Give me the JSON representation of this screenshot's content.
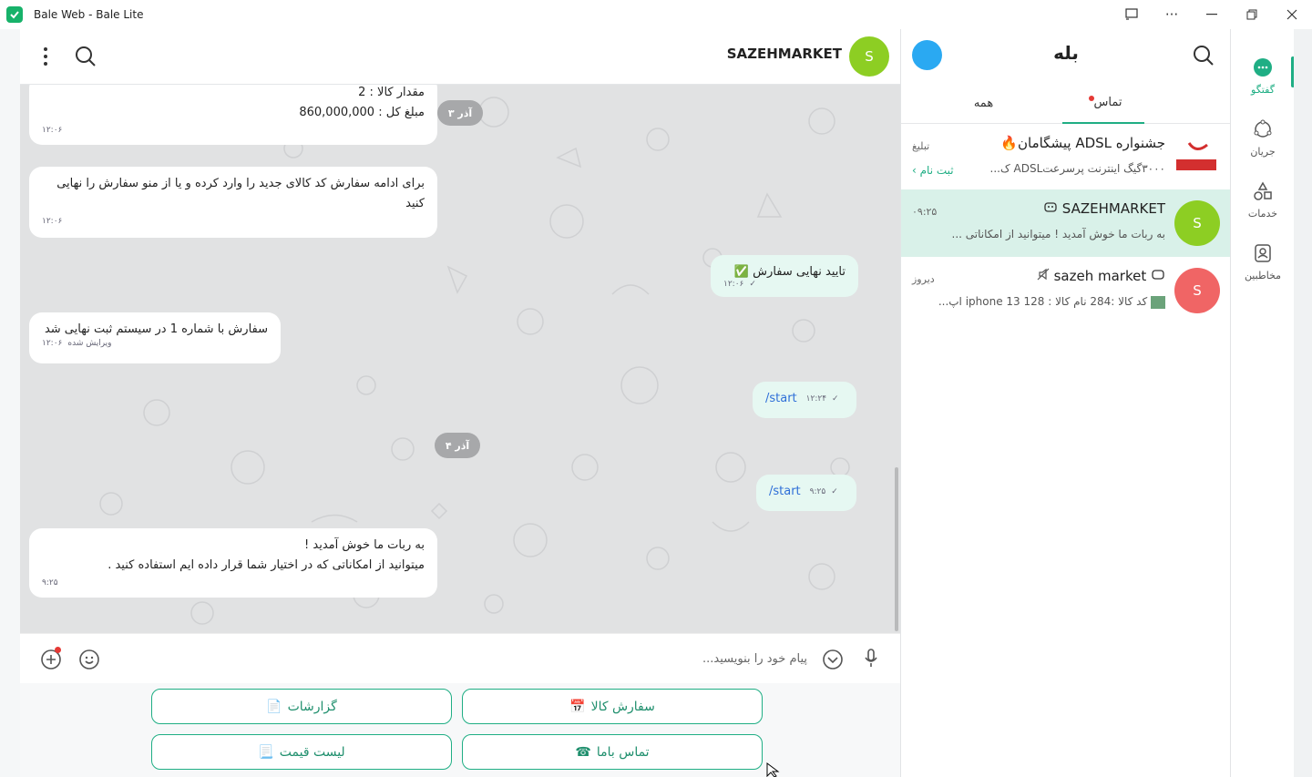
{
  "window": {
    "title": "Bale Web - Bale Lite",
    "controls": [
      "cast",
      "more",
      "minimize",
      "maximize",
      "close"
    ]
  },
  "chat": {
    "header": {
      "name": "SAZEHMARKET",
      "avatar_letter": "S"
    },
    "messages": [
      {
        "dir": "in",
        "lines": [
          "مقدار کالا  :  2",
          "مبلغ کل : 860,000,000"
        ],
        "time": "۱۲:۰۶"
      },
      {
        "dir": "in",
        "lines": [
          "برای ادامه سفارش کد کالای جدید را وارد کرده و یا از منو  سفارش را نهایی",
          "کنید"
        ],
        "time": "۱۲:۰۶"
      },
      {
        "dir": "out",
        "lines": [
          "تایید نهایی سفارش ✅"
        ],
        "time": "۱۲:۰۶"
      },
      {
        "dir": "in",
        "lines": [
          "سفارش با شماره 1 در سیستم ثبت نهایی شد"
        ],
        "time": "۱۲:۰۶",
        "edited": "ویرایش شده"
      },
      {
        "dir": "out",
        "lines": [
          "/start"
        ],
        "time": "۱۲:۲۴"
      },
      {
        "dir": "out",
        "lines": [
          "/start"
        ],
        "time": "۹:۲۵"
      },
      {
        "dir": "in",
        "lines": [
          "به ربات ما خوش آمدید !",
          "میتوانید از امکاناتی که در اختیار شما قرار داده ایم استفاده کنید ."
        ],
        "time": "۹:۲۵"
      }
    ],
    "dates": [
      "۳ آذر",
      "۴ آذر"
    ],
    "composer": {
      "placeholder": "پیام خود را بنویسید..."
    },
    "keyboard": [
      {
        "label": "سفارش کالا",
        "emoji": "📅"
      },
      {
        "label": "گزارشات",
        "emoji": "📄"
      },
      {
        "label": "تماس باما",
        "emoji": "☎"
      },
      {
        "label": "لیست قیمت",
        "emoji": "📃"
      }
    ]
  },
  "list": {
    "title": "بله",
    "tabs": [
      {
        "label": "تماس",
        "has_dot": true
      },
      {
        "label": "همه",
        "has_dot": false
      }
    ],
    "items": [
      {
        "name": "جشنواره ADSL پیشگامان🔥",
        "preview": "۳۰۰۰گیگ اینترنت پرسرعتADSL ک...",
        "time": "تبلیغ",
        "extra": "ثبت نام ›",
        "avatar_text": "پیشگامان"
      },
      {
        "name": "SAZEHMARKET",
        "preview": "به ربات ما خوش آمدید ! میتوانید از امکاناتی ...",
        "time": "۰۹:۲۵",
        "avatar_letter": "S",
        "avatar_color": "#8dce23"
      },
      {
        "name": "sazeh market",
        "preview": "کد کالا :284 نام کالا : iphone 13 128 اپ...",
        "time": "دیروز",
        "avatar_letter": "S",
        "avatar_color": "#f06565"
      }
    ]
  },
  "rail": {
    "items": [
      "گفتگو",
      "جریان",
      "خدمات",
      "مخاطبین"
    ]
  },
  "colors": {
    "accent": "#1fae84",
    "chat_bg": "#e1e2e3",
    "out_bubble": "#e6f8f2"
  }
}
